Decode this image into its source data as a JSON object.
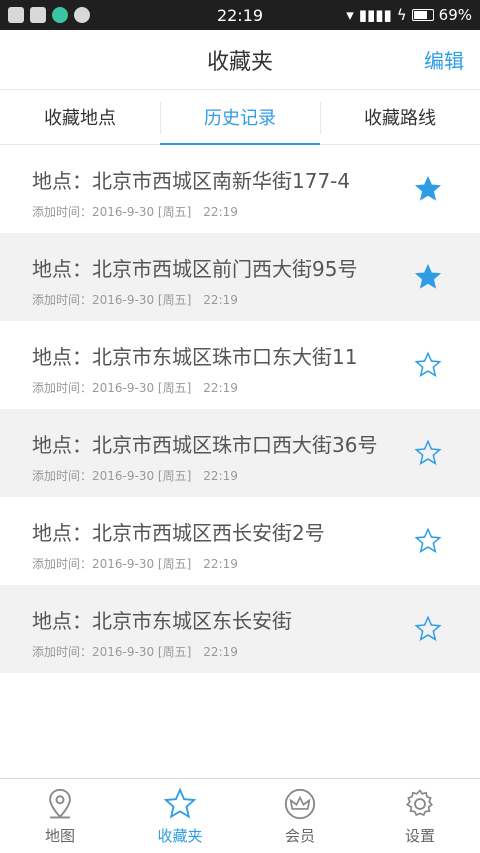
{
  "status": {
    "time": "22:19",
    "battery": "69%"
  },
  "header": {
    "title": "收藏夹",
    "edit_label": "编辑"
  },
  "tabs": [
    {
      "label": "收藏地点"
    },
    {
      "label": "历史记录"
    },
    {
      "label": "收藏路线"
    }
  ],
  "colors": {
    "accent": "#2f9de5",
    "alt_row": "#f2f2f2"
  },
  "items": [
    {
      "place": "地点：北京市西城区南新华街177-4",
      "meta": "添加时间：2016-9-30 [周五]",
      "time": "22:19",
      "starred": true
    },
    {
      "place": "地点：北京市西城区前门西大街95号",
      "meta": "添加时间：2016-9-30 [周五]",
      "time": "22:19",
      "starred": true
    },
    {
      "place": "地点：北京市东城区珠市口东大街11",
      "meta": "添加时间：2016-9-30 [周五]",
      "time": "22:19",
      "starred": false
    },
    {
      "place": "地点：北京市西城区珠市口西大街36号",
      "meta": "添加时间：2016-9-30 [周五]",
      "time": "22:19",
      "starred": false
    },
    {
      "place": "地点：北京市西城区西长安街2号",
      "meta": "添加时间：2016-9-30 [周五]",
      "time": "22:19",
      "starred": false
    },
    {
      "place": "地点：北京市东城区东长安街",
      "meta": "添加时间：2016-9-30 [周五]",
      "time": "22:19",
      "starred": false
    }
  ],
  "nav": [
    {
      "label": "地图",
      "icon": "map-pin-icon"
    },
    {
      "label": "收藏夹",
      "icon": "star-icon"
    },
    {
      "label": "会员",
      "icon": "crown-icon"
    },
    {
      "label": "设置",
      "icon": "gear-icon"
    }
  ]
}
